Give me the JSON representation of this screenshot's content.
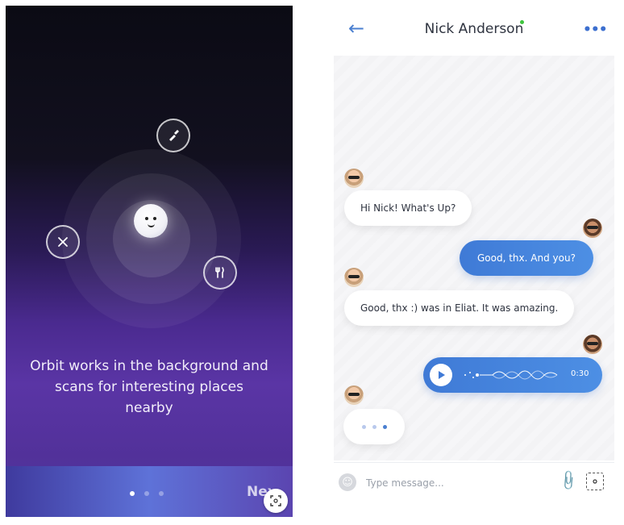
{
  "onboarding": {
    "description": "Orbit works in the background and scans for interesting places nearby",
    "next_label": "Next",
    "page_index": 1,
    "page_count": 3,
    "icons": [
      "flashlight-icon",
      "tools-icon",
      "fork-knife-icon",
      "scan-icon"
    ]
  },
  "chat": {
    "contact_name": "Nick Anderson",
    "contact_status": "online",
    "messages": [
      {
        "sender": "them",
        "text": "Hi Nick! What's Up?"
      },
      {
        "sender": "me",
        "text": "Good, thx. And you?"
      },
      {
        "sender": "them",
        "text": "Good, thx :) was in Eliat. It was amazing."
      },
      {
        "sender": "me",
        "type": "voice",
        "duration": "0:30"
      },
      {
        "sender": "them",
        "type": "typing"
      }
    ],
    "input_placeholder": "Type message...",
    "colors": {
      "accent": "#4a7fd0",
      "online": "#3ec43e"
    }
  }
}
